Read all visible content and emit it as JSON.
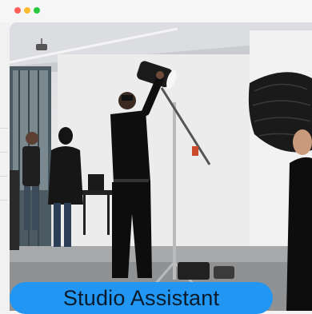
{
  "window": {
    "controls": [
      "close",
      "minimize",
      "maximize"
    ]
  },
  "card": {
    "image_alt": "Studio Assistant",
    "caption": "Studio Assistant"
  },
  "colors": {
    "caption_bg": "#2196f3",
    "caption_text": "#0b1a2a",
    "titlebar_bg": "#f6f6f6"
  }
}
